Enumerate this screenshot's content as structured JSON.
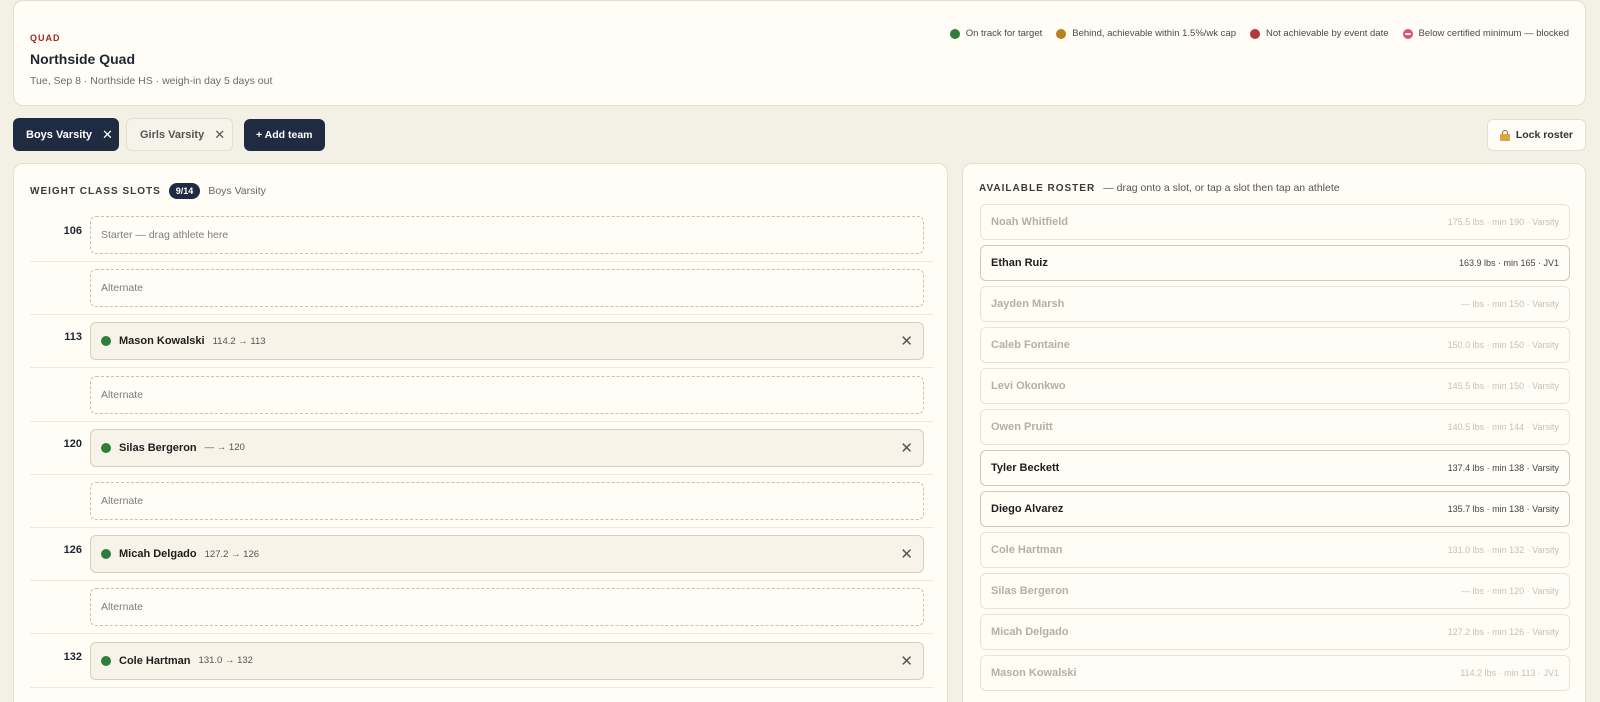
{
  "event": {
    "eyebrow": "QUAD",
    "title": "Northside Quad",
    "subtitle": "Tue, Sep 8 · Northside HS · weigh-in day 5 days out"
  },
  "legend": [
    {
      "label": "On track for target",
      "color": "#2e7d3a"
    },
    {
      "label": "Behind, achievable within 1.5%/wk cap",
      "color": "#b8801f"
    },
    {
      "label": "Not achievable by event date",
      "color": "#b23a3a"
    },
    {
      "label": "Below certified minimum — blocked",
      "color": "#e0507a"
    }
  ],
  "tabs": [
    {
      "label": "Boys Varsity",
      "active": true
    },
    {
      "label": "Girls Varsity",
      "active": false
    }
  ],
  "actions": {
    "add_team": "+ Add team",
    "lock_roster": "Lock roster"
  },
  "slots_panel": {
    "title": "WEIGHT CLASS SLOTS",
    "count": "9/14",
    "team": "Boys Varsity",
    "rows": [
      {
        "weight_class": "106",
        "type": "starter",
        "empty_label": "Starter — drag athlete here"
      },
      {
        "weight_class": "",
        "type": "alternate",
        "empty_label": "Alternate"
      },
      {
        "weight_class": "113",
        "type": "starter",
        "athlete": "Mason Kowalski",
        "weights": "114.2 → 113",
        "status": "#2e7d3a"
      },
      {
        "weight_class": "",
        "type": "alternate",
        "empty_label": "Alternate"
      },
      {
        "weight_class": "120",
        "type": "starter",
        "athlete": "Silas Bergeron",
        "weights": "— → 120",
        "status": "#2e7d3a"
      },
      {
        "weight_class": "",
        "type": "alternate",
        "empty_label": "Alternate"
      },
      {
        "weight_class": "126",
        "type": "starter",
        "athlete": "Micah Delgado",
        "weights": "127.2 → 126",
        "status": "#2e7d3a"
      },
      {
        "weight_class": "",
        "type": "alternate",
        "empty_label": "Alternate"
      },
      {
        "weight_class": "132",
        "type": "starter",
        "athlete": "Cole Hartman",
        "weights": "131.0 → 132",
        "status": "#2e7d3a"
      }
    ]
  },
  "roster_panel": {
    "title": "AVAILABLE ROSTER",
    "hint": "— drag onto a slot, or tap a slot then tap an athlete",
    "athletes": [
      {
        "name": "Noah Whitfield",
        "meta": "175.5 lbs · min 190 · Varsity",
        "available": false
      },
      {
        "name": "Ethan Ruiz",
        "meta": "163.9 lbs · min 165 · JV1",
        "available": true
      },
      {
        "name": "Jayden Marsh",
        "meta": "— lbs · min 150 · Varsity",
        "available": false
      },
      {
        "name": "Caleb Fontaine",
        "meta": "150.0 lbs · min 150 · Varsity",
        "available": false
      },
      {
        "name": "Levi Okonkwo",
        "meta": "145.5 lbs · min 150 · Varsity",
        "available": false
      },
      {
        "name": "Owen Pruitt",
        "meta": "140.5 lbs · min 144 · Varsity",
        "available": false
      },
      {
        "name": "Tyler Beckett",
        "meta": "137.4 lbs · min 138 · Varsity",
        "available": true
      },
      {
        "name": "Diego Alvarez",
        "meta": "135.7 lbs · min 138 · Varsity",
        "available": true
      },
      {
        "name": "Cole Hartman",
        "meta": "131.0 lbs · min 132 · Varsity",
        "available": false
      },
      {
        "name": "Silas Bergeron",
        "meta": "— lbs · min 120 · Varsity",
        "available": false
      },
      {
        "name": "Micah Delgado",
        "meta": "127.2 lbs · min 126 · Varsity",
        "available": false
      },
      {
        "name": "Mason Kowalski",
        "meta": "114.2 lbs · min 113 · JV1",
        "available": false
      }
    ]
  }
}
